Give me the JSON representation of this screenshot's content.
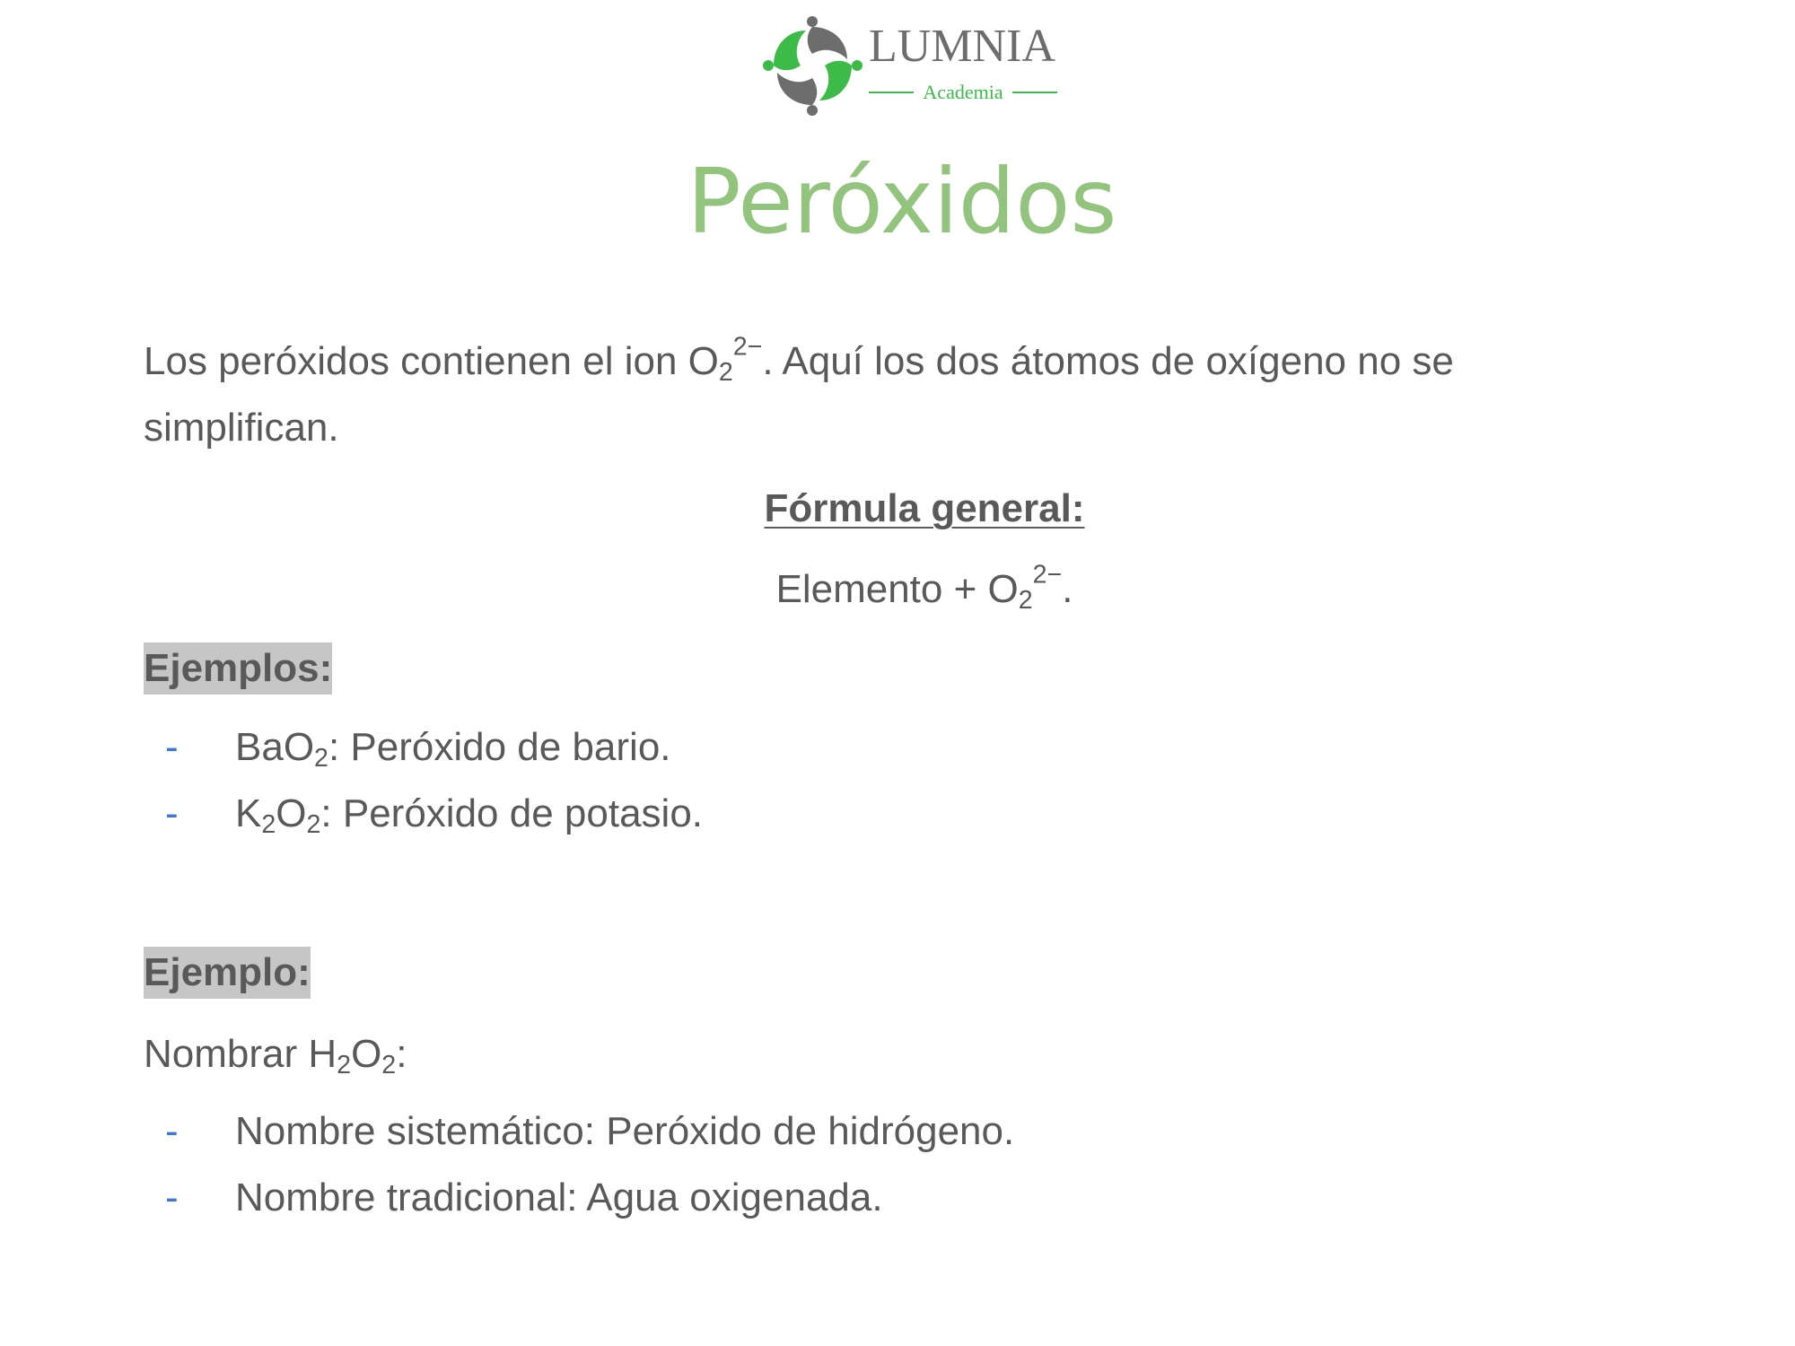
{
  "logo": {
    "name": "LUMNIA",
    "subtitle": "Academia",
    "colors": {
      "green": "#3dbb48",
      "gray": "#6d6d6d"
    }
  },
  "title": "Peróxidos",
  "intro": {
    "text_before_ion": "Los peróxidos contienen el ion O",
    "ion_sub": "2",
    "ion_sup": "2−",
    "text_after_ion": ". Aquí los dos átomos de oxígeno no se simplifican."
  },
  "formula": {
    "heading": "Fórmula general:",
    "line_before": "Elemento + O",
    "sub": "2",
    "sup": "2−",
    "line_after": "."
  },
  "examples": {
    "label": "Ejemplos:",
    "dash": "-",
    "items": [
      {
        "f1": "BaO",
        "s1": "2",
        "rest": ": Peróxido de bario."
      },
      {
        "f1": "K",
        "s1": "2",
        "f2": "O",
        "s2": "2",
        "rest": ": Peróxido de potasio."
      }
    ]
  },
  "example": {
    "label": "Ejemplo:",
    "prompt": {
      "t1": "Nombrar H",
      "s1": "2",
      "t2": "O",
      "s2": "2",
      "t3": ":"
    },
    "items": [
      "Nombre sistemático: Peróxido de hidrógeno.",
      "Nombre tradicional: Agua oxigenada."
    ]
  },
  "colors": {
    "title": "#93c47d",
    "body_text": "#595959",
    "dash": "#3c78d8",
    "highlight": "#c6c6c6"
  }
}
